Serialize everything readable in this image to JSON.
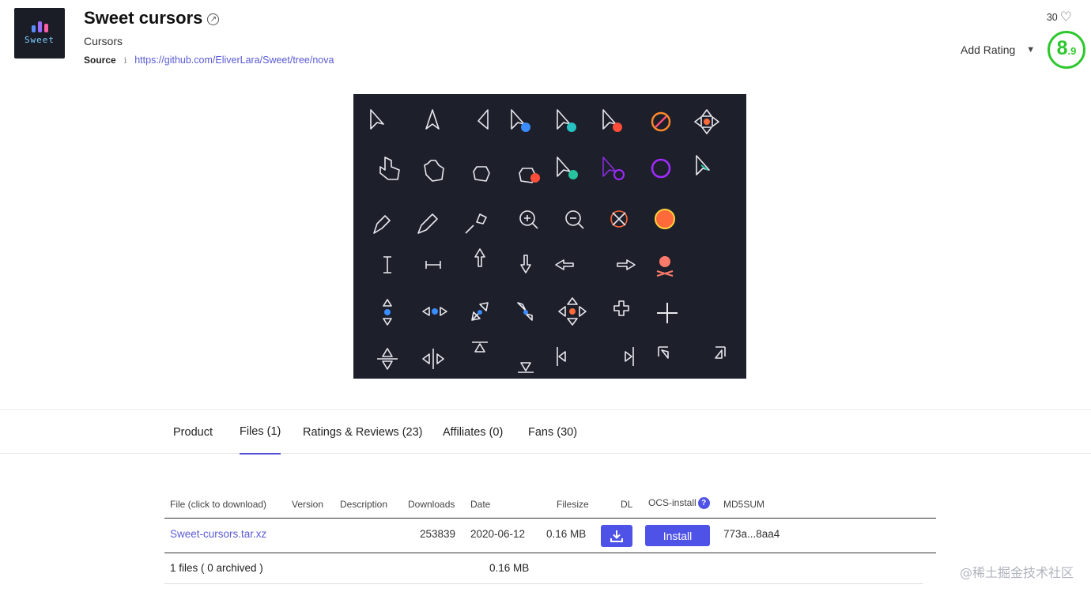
{
  "header": {
    "logo_text": "Sweet",
    "title": "Sweet cursors",
    "category": "Cursors",
    "source_label": "Source",
    "source_url": "https://github.com/EliverLara/Sweet/tree/nova"
  },
  "rating": {
    "fans_count": "30",
    "add_rating_label": "Add Rating",
    "score_main": "8",
    "score_decimal": ".9",
    "score_color": "#2ec82e"
  },
  "tabs": [
    {
      "label": "Product"
    },
    {
      "label": "Files (1)"
    },
    {
      "label": "Ratings & Reviews (23)"
    },
    {
      "label": "Affiliates (0)"
    },
    {
      "label": "Fans (30)"
    }
  ],
  "files_table": {
    "headers": {
      "file": "File (click to download)",
      "version": "Version",
      "description": "Description",
      "downloads": "Downloads",
      "date": "Date",
      "filesize": "Filesize",
      "dl": "DL",
      "ocs_install": "OCS-install",
      "md5sum": "MD5SUM"
    },
    "rows": [
      {
        "file": "Sweet-cursors.tar.xz",
        "version": "",
        "description": "",
        "downloads": "253839",
        "date": "2020-06-12",
        "filesize": "0.16 MB",
        "install_label": "Install",
        "md5sum": "773a...8aa4"
      }
    ],
    "footer": {
      "summary": "1 files ( 0 archived )",
      "total_size": "0.16 MB"
    }
  },
  "watermark": "@稀土掘金技术社区",
  "colors": {
    "accent": "#4f52e6",
    "link": "#5a5bd4",
    "preview_bg": "#1d1f2a"
  }
}
